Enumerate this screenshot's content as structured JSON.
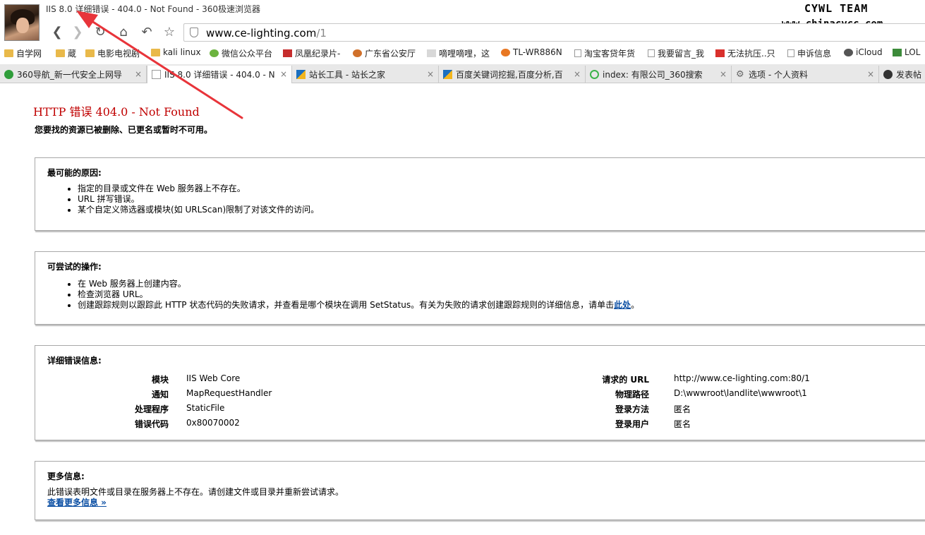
{
  "window": {
    "title": "IIS 8.0 详细错误 - 404.0 - Not Found - 360极速浏览器"
  },
  "watermark": {
    "line1": "CYWL TEAM",
    "line2": "www.chinacycc.com"
  },
  "nav": {
    "back_icon": "back-arrow-icon",
    "forward_icon": "forward-arrow-icon",
    "refresh_icon": "refresh-icon",
    "home_icon": "home-icon",
    "undo_icon": "undo-icon",
    "star_icon": "star-icon",
    "url_host": "www.ce-lighting.com",
    "url_path": "/1"
  },
  "bookmarks": [
    {
      "label": "自学网",
      "icon": "folder-icon"
    },
    {
      "label": "蔵",
      "icon": "folder-icon"
    },
    {
      "label": "电影电视剧",
      "icon": "folder-icon"
    },
    {
      "label": "kali linux",
      "icon": "folder-icon"
    },
    {
      "label": "微信公众平台",
      "icon": "wechat-icon"
    },
    {
      "label": "凤凰纪录片-",
      "icon": "ifeng-icon"
    },
    {
      "label": "广东省公安厅",
      "icon": "police-icon"
    },
    {
      "label": "嘀哩嘀哩，这",
      "icon": "face-icon"
    },
    {
      "label": "TL-WR886N",
      "icon": "router-icon"
    },
    {
      "label": "淘宝客贷年货",
      "icon": "page-icon"
    },
    {
      "label": "我要留言_我",
      "icon": "page-icon"
    },
    {
      "label": "无法抗压..只",
      "icon": "red-icon"
    },
    {
      "label": "申诉信息",
      "icon": "page-icon"
    },
    {
      "label": "iCloud",
      "icon": "apple-icon"
    },
    {
      "label": "LOL",
      "icon": "lol-icon"
    }
  ],
  "tabs": [
    {
      "label": "360导航_新一代安全上网导",
      "active": false
    },
    {
      "label": "IIS 8.0 详细错误 - 404.0 - N",
      "active": true
    },
    {
      "label": "站长工具 - 站长之家",
      "active": false
    },
    {
      "label": "百度关键词挖掘,百度分析,百",
      "active": false
    },
    {
      "label": "index: 有限公司_360搜索",
      "active": false
    },
    {
      "label": "选项 - 个人资料",
      "active": false
    },
    {
      "label": "发表帖",
      "active": false
    }
  ],
  "tab_close": "×",
  "page": {
    "error_title": "HTTP 错误 404.0 - Not Found",
    "error_subtitle": "您要找的资源已被删除、已更名或暂时不可用。",
    "causes": {
      "heading": "最可能的原因:",
      "items": [
        "指定的目录或文件在 Web 服务器上不存在。",
        "URL 拼写错误。",
        "某个自定义筛选器或模块(如 URLScan)限制了对该文件的访问。"
      ]
    },
    "actions": {
      "heading": "可尝试的操作:",
      "item1": "在 Web 服务器上创建内容。",
      "item2": "检查浏览器 URL。",
      "item3_pre": "创建跟踪规则以跟踪此 HTTP 状态代码的失败请求，并查看是哪个模块在调用 SetStatus。有关为失败的请求创建跟踪规则的详细信息，请单击",
      "item3_link": "此处",
      "item3_post": "。"
    },
    "details": {
      "heading": "详细错误信息:",
      "left": [
        {
          "key": "模块",
          "value": "IIS Web Core"
        },
        {
          "key": "通知",
          "value": "MapRequestHandler"
        },
        {
          "key": "处理程序",
          "value": "StaticFile"
        },
        {
          "key": "错误代码",
          "value": "0x80070002"
        }
      ],
      "right": [
        {
          "key": "请求的 URL",
          "value": "http://www.ce-lighting.com:80/1"
        },
        {
          "key": "物理路径",
          "value": "D:\\wwwroot\\landlite\\wwwroot\\1"
        },
        {
          "key": "登录方法",
          "value": "匿名"
        },
        {
          "key": "登录用户",
          "value": "匿名"
        }
      ]
    },
    "more": {
      "heading": "更多信息:",
      "text": "此错误表明文件或目录在服务器上不存在。请创建文件或目录并重新尝试请求。",
      "link": "查看更多信息 »"
    }
  },
  "colors": {
    "error_red": "#c00000",
    "link_blue": "#0a4ea3",
    "annotation_arrow": "#e8343a"
  }
}
